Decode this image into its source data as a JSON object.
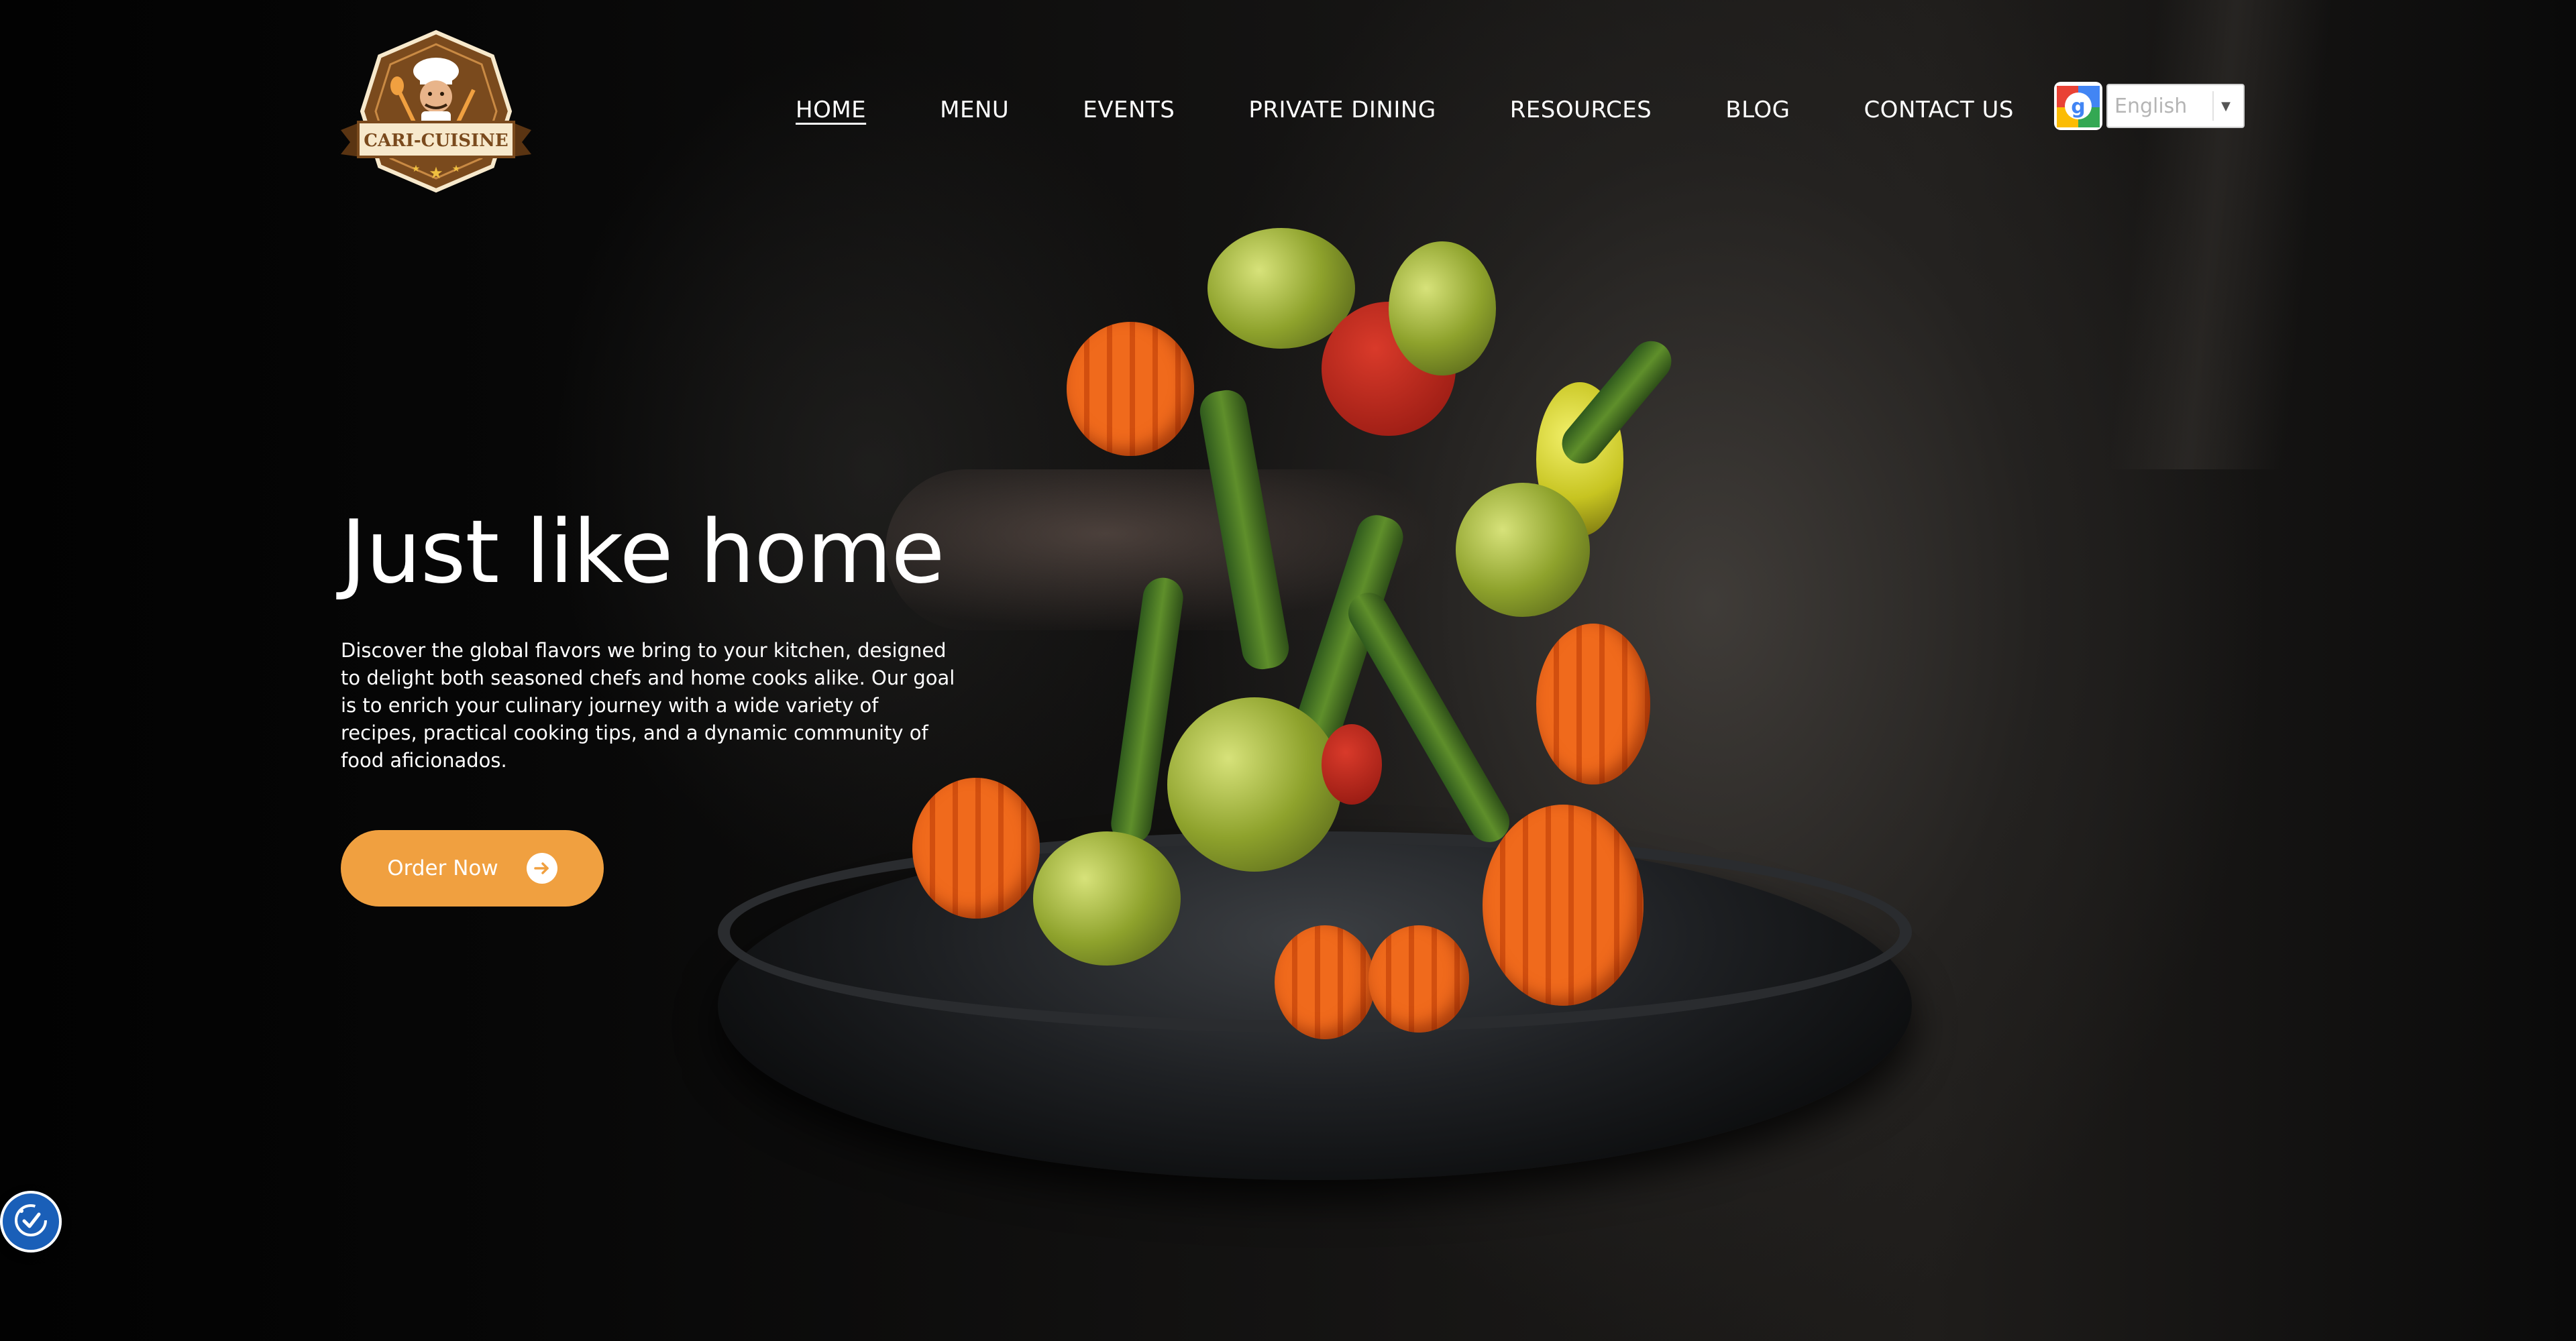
{
  "brand": {
    "logo_text": "CARI-CUISINE",
    "colors": {
      "brand_brown": "#7a4a1d",
      "brand_cream": "#f7e9cc",
      "accent_orange": "#f0a040"
    }
  },
  "nav": {
    "items": [
      {
        "label": "HOME",
        "active": true
      },
      {
        "label": "MENU"
      },
      {
        "label": "EVENTS"
      },
      {
        "label": "PRIVATE DINING"
      },
      {
        "label": "RESOURCES"
      },
      {
        "label": "BLOG"
      },
      {
        "label": "CONTACT US"
      }
    ]
  },
  "translate": {
    "icon": "google-translate-icon",
    "selected_language": "English"
  },
  "hero": {
    "title": "Just like home",
    "description": "Discover the global flavors we bring to your kitchen, designed to delight both seasoned chefs and home cooks alike. Our goal is to enrich your culinary journey with a wide variety of recipes, practical cooking tips, and a dynamic community of food aficionados.",
    "cta_label": "Order Now",
    "cta_icon": "arrow-right-circle-icon"
  },
  "accessibility": {
    "icon": "accessibility-icon"
  }
}
